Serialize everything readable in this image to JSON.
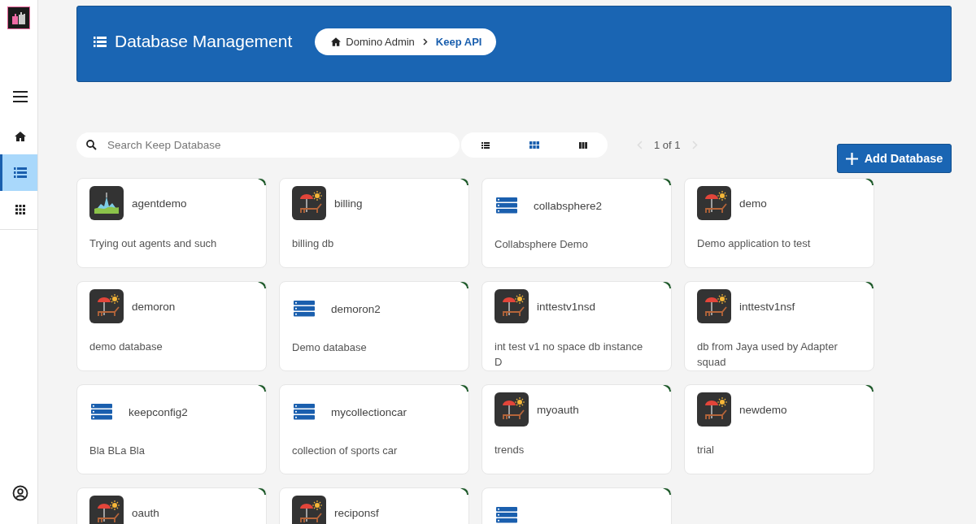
{
  "sidebar": {
    "items": [
      {
        "kind": "home",
        "selected": false
      },
      {
        "kind": "list",
        "selected": true
      },
      {
        "kind": "apps",
        "selected": false
      }
    ]
  },
  "header": {
    "title": "Database Management",
    "breadcrumb": [
      {
        "label": "Domino Admin",
        "kind": "home"
      },
      {
        "label": "Keep API",
        "kind": "current"
      }
    ]
  },
  "toolbar": {
    "search": {
      "placeholder": "Search Keep Database"
    },
    "views": [
      {
        "kind": "list",
        "selected": false
      },
      {
        "kind": "grid",
        "selected": true
      },
      {
        "kind": "columns",
        "selected": false
      }
    ],
    "pager": {
      "text": "1 of 1",
      "prev_disabled": true,
      "next_disabled": true
    },
    "add_button": "Add Database"
  },
  "databases": [
    {
      "name": "agentdemo",
      "description": "Trying out agents and such",
      "kind": "landscape"
    },
    {
      "name": "billing",
      "description": "billing db",
      "kind": "app"
    },
    {
      "name": "collabsphere2",
      "description": "Collabsphere Demo",
      "kind": "database"
    },
    {
      "name": "demo",
      "description": "Demo application to test",
      "kind": "app"
    },
    {
      "name": "demoron",
      "description": "demo database",
      "kind": "app"
    },
    {
      "name": "demoron2",
      "description": "Demo database",
      "kind": "database"
    },
    {
      "name": "inttestv1nsd",
      "description": "int test v1 no space db instance D",
      "kind": "app"
    },
    {
      "name": "inttestv1nsf",
      "description": "db from Jaya used by Adapter squad",
      "kind": "app"
    },
    {
      "name": "keepconfig2",
      "description": "Bla BLa Bla",
      "kind": "database"
    },
    {
      "name": "mycollectioncar",
      "description": "collection of sports car",
      "kind": "database"
    },
    {
      "name": "myoauth",
      "description": "trends",
      "kind": "app"
    },
    {
      "name": "newdemo",
      "description": "trial",
      "kind": "app"
    },
    {
      "name": "oauth",
      "kind": "app"
    },
    {
      "name": "reciponsf",
      "kind": "app"
    },
    {
      "kind": "database"
    }
  ]
}
